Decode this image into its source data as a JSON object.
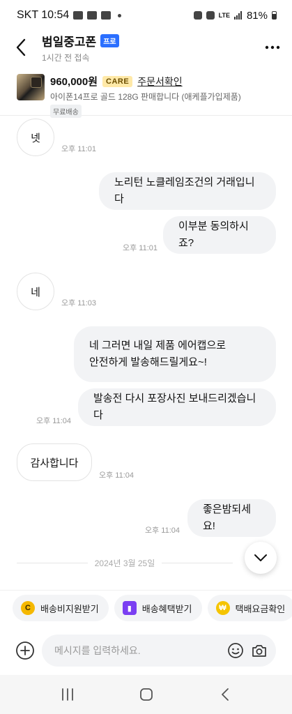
{
  "status": {
    "carrier_time": "SKT 10:54",
    "network": "LTE",
    "battery": "81%"
  },
  "header": {
    "seller_name": "범일중고폰",
    "badge": "프로",
    "last_seen": "1시간 전 접속"
  },
  "product": {
    "price": "960,000원",
    "care_badge": "CARE",
    "order_link": "주문서확인",
    "title": "아이폰14프로 골드 128G 판매합니다 (애케플가입제품)",
    "shipping_tag": "무료배송"
  },
  "messages": [
    {
      "side": "in",
      "text": "넷",
      "time": "오후 11:01"
    },
    {
      "side": "out",
      "text": "노리턴 노클레임조건의 거래입니다",
      "time": ""
    },
    {
      "side": "out",
      "text": "이부분 동의하시죠?",
      "time": "오후 11:01"
    },
    {
      "side": "in",
      "text": "네",
      "time": "오후 11:03"
    },
    {
      "side": "out",
      "text": "네 그러면 내일 제품 에어캡으로\n안전하게 발송해드릴게요~!",
      "time": ""
    },
    {
      "side": "out",
      "text": "발송전 다시 포장사진 보내드리겠습니다",
      "time": "오후 11:04"
    },
    {
      "side": "in",
      "text": "감사합니다",
      "time": "오후 11:04"
    },
    {
      "side": "out",
      "text": "좋은밤되세요!",
      "time": "오후 11:04"
    }
  ],
  "date_divider": "2024년 3월 25일",
  "chips": [
    {
      "label": "배송비지원받기",
      "icon": "coin-c-icon",
      "color": "#f5b800"
    },
    {
      "label": "배송혜택받기",
      "icon": "gift-icon",
      "color": "#7b3ff2"
    },
    {
      "label": "택배요금확인",
      "icon": "won-coin-icon",
      "color": "#f5c400"
    }
  ],
  "input": {
    "placeholder": "메시지를 입력하세요."
  },
  "colors": {
    "accent_blue": "#2b6fff",
    "care_yellow": "#ffe9a8",
    "bubble_gray": "#f2f3f5"
  }
}
